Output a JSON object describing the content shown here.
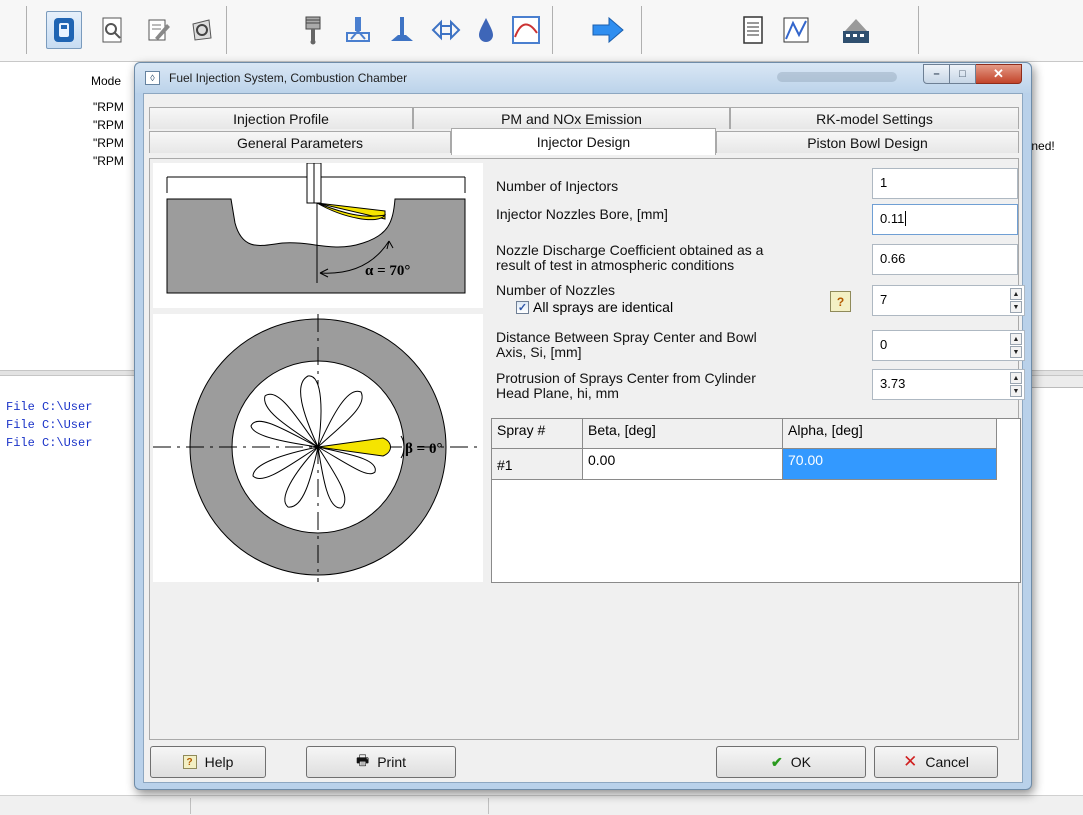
{
  "toolbar": {
    "icons": [
      "app-icon",
      "preview-icon",
      "edit-icon",
      "refresh-icon",
      "piston-icon",
      "injector-icon",
      "valve-icon",
      "flow-icon",
      "fuel-drop-icon",
      "curve-chart-icon",
      "arrow-right-icon",
      "report-icon",
      "graph-icon",
      "movie-icon"
    ]
  },
  "background": {
    "mode_header": "Mode",
    "rpm_rows": [
      "\"RPM",
      "\"RPM",
      "\"RPM",
      "\"RPM"
    ],
    "right_text": "ained!",
    "log_lines": [
      "File C:\\User",
      "File C:\\User",
      "File C:\\User"
    ]
  },
  "dialog": {
    "title": "Fuel Injection System, Combustion Chamber",
    "title_icon": "window-app-icon",
    "window_buttons": {
      "minimize": "–",
      "maximize": "□",
      "close": "✕"
    },
    "tabs_row1": [
      "Injection Profile",
      "PM and NOx Emission",
      "RK-model Settings"
    ],
    "tabs_row2": [
      "General Parameters",
      "Injector Design",
      "Piston Bowl Design"
    ],
    "selected_tab": "Injector Design",
    "diagram": {
      "alpha_label": "α = 70°",
      "beta_label": "β = 0°",
      "spray_color": "#f5e400"
    },
    "fields": {
      "num_injectors": {
        "label": "Number of Injectors",
        "value": "1"
      },
      "nozzle_bore": {
        "label": "Injector Nozzles Bore, [mm]",
        "value": "0.11"
      },
      "discharge_coef": {
        "label_line1": "Nozzle Discharge Coefficient obtained as a",
        "label_line2": "result of test in atmospheric conditions",
        "value": "0.66"
      },
      "num_nozzles": {
        "label": "Number of Nozzles",
        "value": "7"
      },
      "identical": {
        "label": "All sprays are identical",
        "checked": true
      },
      "distance": {
        "label_line1": "Distance Between Spray Center and Bowl",
        "label_line2": "Axis, Si, [mm]",
        "value": "0"
      },
      "protrusion": {
        "label_line1": "Protrusion of Sprays Center from Cylinder",
        "label_line2": "Head Plane, hi, mm",
        "value": "3.73"
      }
    },
    "grid": {
      "headers": [
        "Spray #",
        "Beta, [deg]",
        "Alpha, [deg]"
      ],
      "rows": [
        [
          "#1",
          "0.00",
          "70.00"
        ]
      ]
    },
    "buttons": {
      "help": "Help",
      "print": "Print",
      "ok": "OK",
      "cancel": "Cancel"
    },
    "help_glyph": "?"
  }
}
